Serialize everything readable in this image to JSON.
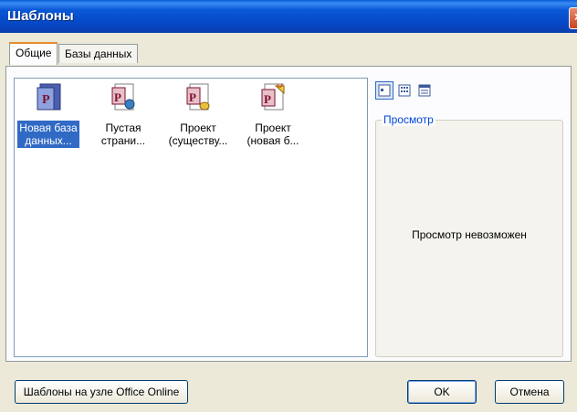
{
  "window": {
    "title": "Шаблоны",
    "close_glyph": "×"
  },
  "tabs": [
    {
      "label": "Общие",
      "active": true
    },
    {
      "label": "Базы данных",
      "active": false
    }
  ],
  "items": [
    {
      "label": "Новая база\nданных...",
      "icon": "access-database-icon",
      "selected": true
    },
    {
      "label": "Пустая\nстрани...",
      "icon": "access-page-icon",
      "selected": false
    },
    {
      "label": "Проект\n(существу...",
      "icon": "access-project-existing-icon",
      "selected": false
    },
    {
      "label": "Проект\n(новая б...",
      "icon": "access-project-new-icon",
      "selected": false
    }
  ],
  "view_modes": [
    "large-icons-icon",
    "list-view-icon",
    "details-view-icon"
  ],
  "preview": {
    "legend": "Просмотр",
    "message": "Просмотр невозможен"
  },
  "buttons": {
    "online": "Шаблоны на узле Office Online",
    "ok": "OK",
    "cancel": "Отмена"
  },
  "colors": {
    "titlebar": "#0a58d6",
    "selection": "#316ac5",
    "legend": "#0046d5",
    "tab_highlight": "#e68b2c"
  }
}
